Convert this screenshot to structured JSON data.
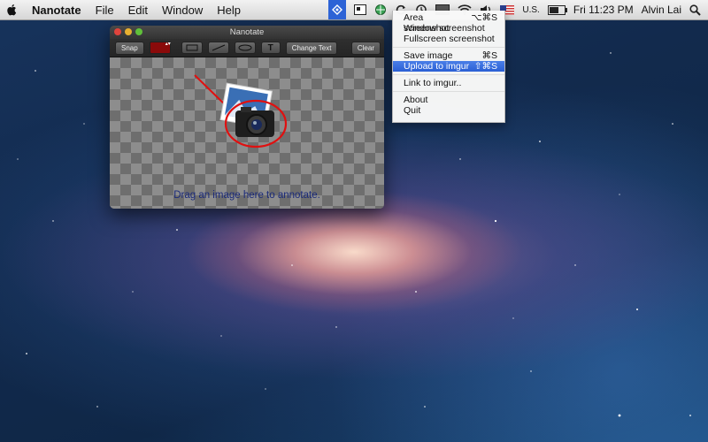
{
  "menubar": {
    "app_name": "Nanotate",
    "menus": [
      "File",
      "Edit",
      "Window",
      "Help"
    ],
    "clock": "Fri 11:23 PM",
    "user": "Alvin Lai",
    "input_source": "U.S."
  },
  "dropdown": {
    "items": [
      {
        "label": "Area screenshot",
        "shortcut": "⌥⌘S"
      },
      {
        "label": "Window screenshot",
        "shortcut": ""
      },
      {
        "label": "Fullscreen screenshot",
        "shortcut": ""
      },
      {
        "label": "Save image",
        "shortcut": "⌘S"
      },
      {
        "label": "Upload to imgur",
        "shortcut": "⇧⌘S"
      },
      {
        "label": "Link to imgur..",
        "shortcut": ""
      },
      {
        "label": "About",
        "shortcut": ""
      },
      {
        "label": "Quit",
        "shortcut": ""
      }
    ],
    "active_item": "Upload to imgur"
  },
  "window": {
    "title": "Nanotate",
    "toolbar": {
      "snap_label": "Snap",
      "color": "#8a0a0a",
      "text_tool_label": "T",
      "change_text_label": "Change Text",
      "clear_label": "Clear"
    },
    "drop_hint": "Drag an image here to annotate."
  },
  "colors": {
    "menu_highlight": "#2a5fd4",
    "annotation_red": "#e01010",
    "hint_text": "#1a2a7a"
  }
}
